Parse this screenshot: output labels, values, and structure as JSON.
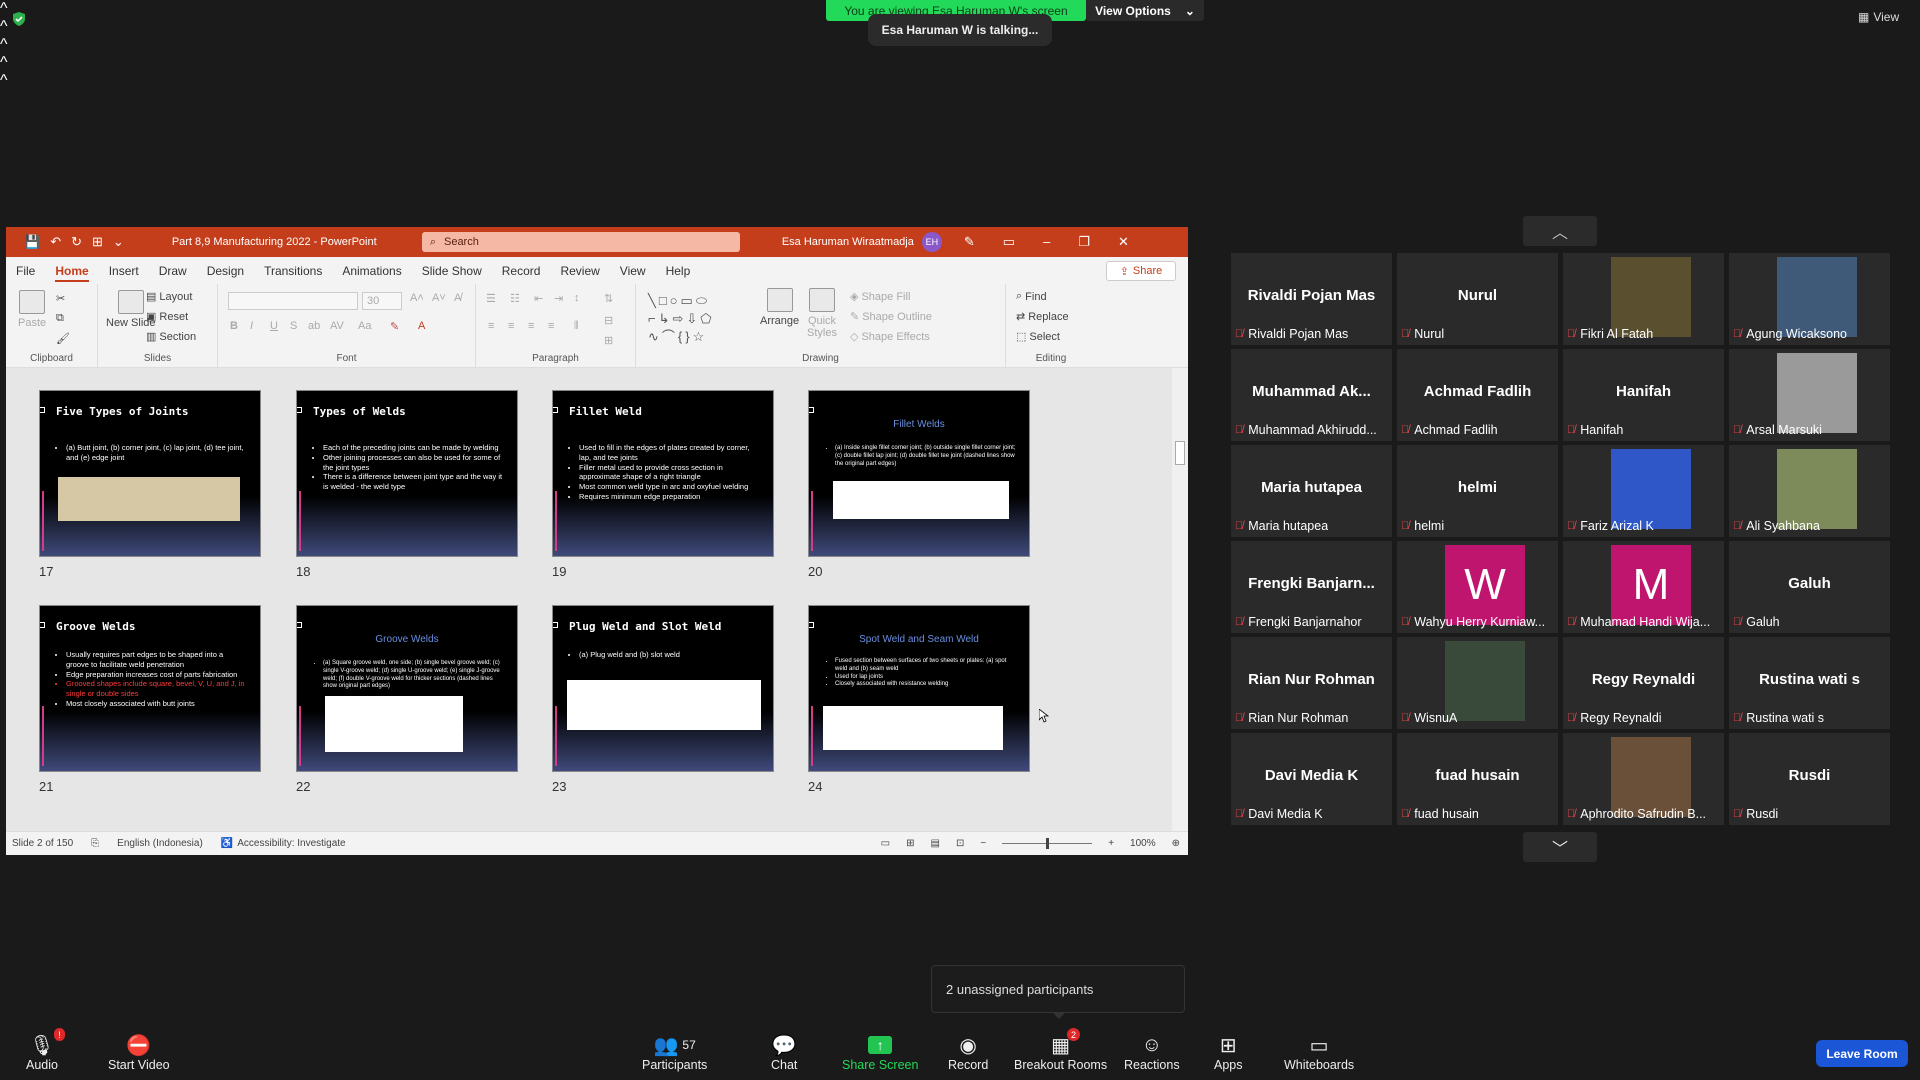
{
  "banner": {
    "viewing": "You are viewing Esa Haruman W's screen",
    "view_options": "View Options",
    "talking": "Esa Haruman W is talking...",
    "view": "View"
  },
  "ppt": {
    "doc_title": "Part 8,9 Manufacturing 2022  -  PowerPoint",
    "search_placeholder": "Search",
    "user": "Esa Haruman Wiraatmadja",
    "avatar": "EH",
    "tabs": [
      "File",
      "Home",
      "Insert",
      "Draw",
      "Design",
      "Transitions",
      "Animations",
      "Slide Show",
      "Record",
      "Review",
      "View",
      "Help"
    ],
    "share": "Share",
    "ribbon": {
      "paste": "Paste",
      "new_slide": "New Slide",
      "layout": "Layout",
      "reset": "Reset",
      "section": "Section",
      "font_size": "30",
      "arrange": "Arrange",
      "quick_styles": "Quick Styles",
      "shape_fill": "Shape Fill",
      "shape_outline": "Shape Outline",
      "shape_effects": "Shape Effects",
      "find": "Find",
      "replace": "Replace",
      "select": "Select",
      "groups": {
        "clipboard": "Clipboard",
        "slides": "Slides",
        "font": "Font",
        "paragraph": "Paragraph",
        "drawing": "Drawing",
        "editing": "Editing"
      }
    },
    "slides": [
      {
        "num": "17",
        "title": "Five Types of Joints",
        "bullets": [
          "(a) Butt joint, (b) corner joint, (c) lap joint, (d) tee joint, and (e) edge joint"
        ]
      },
      {
        "num": "18",
        "title": "Types of Welds",
        "bullets": [
          "Each of the preceding joints can be made by welding",
          "Other joining processes can also be used for some of the joint types",
          "There is a difference between joint type and the way it is welded - the weld type"
        ]
      },
      {
        "num": "19",
        "title": "Fillet Weld",
        "bullets": [
          "Used to fill in the edges of plates created by corner, lap, and tee joints",
          "Filler metal used to provide cross section in approximate shape of a right triangle",
          "Most common weld type in arc and oxyfuel welding",
          "Requires minimum edge preparation"
        ]
      },
      {
        "num": "20",
        "title": "Fillet Welds",
        "bullets": [
          "(a) Inside single fillet corner joint; (b) outside single fillet corner joint; (c) double fillet lap joint; (d) double fillet tee joint (dashed lines show the original part edges)"
        ]
      },
      {
        "num": "21",
        "title": "Groove Welds",
        "bullets": [
          "Usually requires part edges to be shaped into a groove to facilitate weld penetration",
          "Edge preparation increases cost of parts fabrication",
          "Grooved shapes include square, bevel, V, U, and J, in single or double sides",
          "Most closely associated with butt joints"
        ]
      },
      {
        "num": "22",
        "title": "Groove Welds",
        "bullets": [
          "(a) Square groove weld, one side; (b) single bevel groove weld; (c) single V-groove weld; (d) single U-groove weld; (e) single J-groove weld; (f) double V-groove weld for thicker sections (dashed lines show original part edges)"
        ]
      },
      {
        "num": "23",
        "title": "Plug Weld and Slot Weld",
        "bullets": [
          "(a) Plug weld and (b) slot weld"
        ]
      },
      {
        "num": "24",
        "title": "Spot Weld and Seam Weld",
        "bullets": [
          "Fused section between surfaces of two sheets or plates: (a) spot weld and (b) seam weld",
          "Used for lap joints",
          "Closely associated with resistance welding"
        ]
      }
    ],
    "status": {
      "slide": "Slide 2 of 150",
      "language": "English (Indonesia)",
      "accessibility": "Accessibility: Investigate",
      "zoom": "100%"
    }
  },
  "participants": [
    {
      "big": "Rivaldi Pojan Mas",
      "label": "Rivaldi Pojan Mas"
    },
    {
      "big": "Nurul",
      "label": "Nurul"
    },
    {
      "photo": "#5a5030",
      "label": "Fikri Al Fatah"
    },
    {
      "photo": "#3f5a78",
      "label": "Agung Wicaksono"
    },
    {
      "big": "Muhammad  Ak...",
      "label": "Muhammad Akhirudd..."
    },
    {
      "big": "Achmad Fadlih",
      "label": "Achmad Fadlih"
    },
    {
      "big": "Hanifah",
      "label": "Hanifah"
    },
    {
      "photo": "#9a9a9a",
      "label": "Arsal Marsuki"
    },
    {
      "big": "Maria hutapea",
      "label": "Maria hutapea"
    },
    {
      "big": "helmi",
      "label": "helmi"
    },
    {
      "photo": "#2f57c8",
      "label": "Fariz Arizal K"
    },
    {
      "photo": "#7d8a5a",
      "label": "Ali Syahbana"
    },
    {
      "big": "Frengki  Banjarn...",
      "label": "Frengki Banjarnahor"
    },
    {
      "letter": "W",
      "label": "Wahyu Herry Kurniaw..."
    },
    {
      "letter": "M",
      "label": "Muhamad Handi Wija..."
    },
    {
      "big": "Galuh",
      "label": "Galuh"
    },
    {
      "big": "Rian Nur Rohman",
      "label": "Rian Nur Rohman"
    },
    {
      "photo": "#3a4a3a",
      "label": "WisnuA"
    },
    {
      "big": "Regy Reynaldi",
      "label": "Regy Reynaldi"
    },
    {
      "big": "Rustina wati s",
      "label": "Rustina wati s"
    },
    {
      "big": "Davi Media K",
      "label": "Davi Media K"
    },
    {
      "big": "fuad husain",
      "label": "fuad husain"
    },
    {
      "photo": "#6a5038",
      "label": "Aphrodito Safrudin B..."
    },
    {
      "big": "Rusdi",
      "label": "Rusdi"
    }
  ],
  "unassigned": "2 unassigned participants",
  "toolbar": {
    "audio": "Audio",
    "start_video": "Start Video",
    "participants": "Participants",
    "participants_count": "57",
    "chat": "Chat",
    "share_screen": "Share Screen",
    "record": "Record",
    "breakout": "Breakout Rooms",
    "breakout_badge": "2",
    "reactions": "Reactions",
    "apps": "Apps",
    "whiteboards": "Whiteboards",
    "leave": "Leave Room",
    "audio_badge": "!"
  }
}
